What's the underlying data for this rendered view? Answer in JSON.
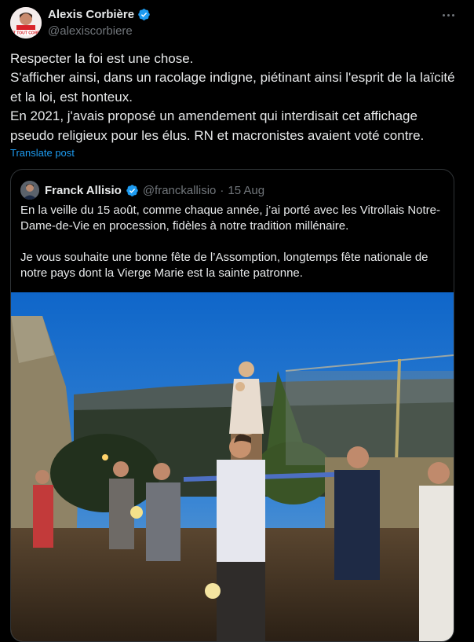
{
  "author": {
    "display_name": "Alexis Corbière",
    "handle": "@alexiscorbiere",
    "avatar_badge": "AVANT TOUT CORBIÈRE"
  },
  "tweet": {
    "lines": [
      "Respecter la foi est une chose.",
      "S'afficher ainsi, dans un racolage indigne, piétinant ainsi l'esprit de la laïcité et la loi, est honteux.",
      "En 2021, j'avais proposé un amendement qui interdisait cet affichage pseudo religieux pour les élus. RN et macronistes avaient voté contre."
    ],
    "translate_label": "Translate post"
  },
  "quoted": {
    "display_name": "Franck Allisio",
    "handle": "@franckallisio",
    "separator": "·",
    "date": "15 Aug",
    "paragraphs": [
      "En la veille du 15 août, comme chaque année, j’ai porté avec les Vitrollais Notre-Dame-de-Vie en procession, fidèles à notre tradition millénaire.",
      "Je vous souhaite une bonne fête de l’Assomption, longtemps fête nationale de notre pays dont la Vierge Marie est la sainte patronne."
    ]
  },
  "icons": {
    "verified": "verified-badge-icon",
    "more": "more-options-icon"
  },
  "colors": {
    "background": "#000000",
    "text": "#e7e9ea",
    "secondary": "#71767b",
    "link": "#1d9bf0",
    "verified": "#1d9bf0",
    "border": "#2f3336"
  }
}
